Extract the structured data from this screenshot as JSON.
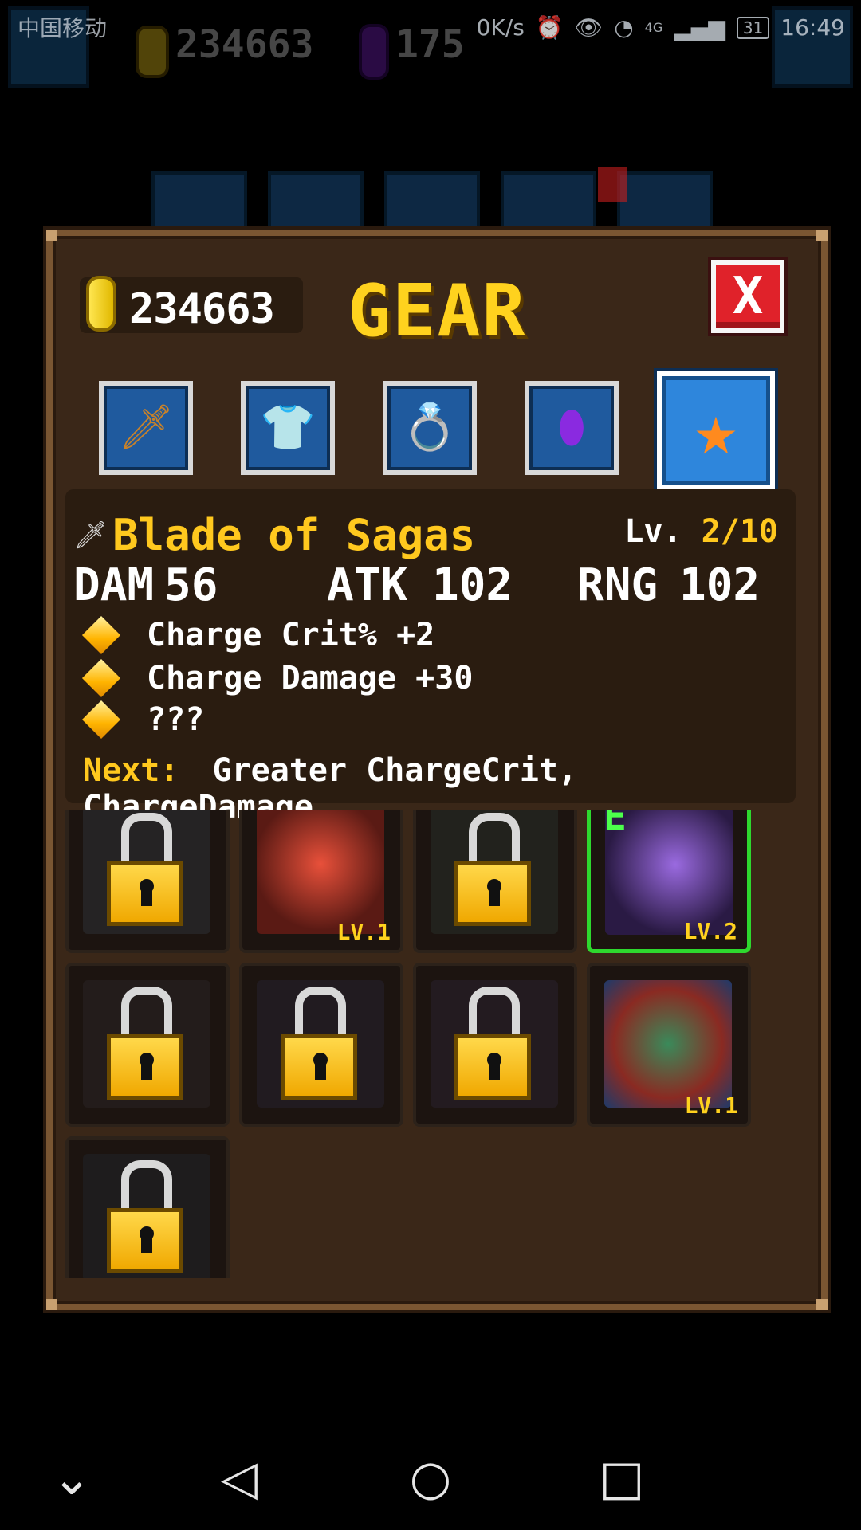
{
  "statusbar": {
    "carrier": "中国移动",
    "speed": "0K/s",
    "network": "4G",
    "battery": "31",
    "time": "16:49"
  },
  "hud": {
    "coins": "234663",
    "gems": "175"
  },
  "panel": {
    "coins": "234663",
    "title": "GEAR",
    "close_label": "X",
    "categories": [
      {
        "name": "weapon",
        "icon": "sword-icon",
        "glyph": "🗡",
        "active": false
      },
      {
        "name": "armor",
        "icon": "shirt-icon",
        "glyph": "👕",
        "active": false
      },
      {
        "name": "ring",
        "icon": "ring-icon",
        "glyph": "💍",
        "active": false
      },
      {
        "name": "gem",
        "icon": "gem-icon",
        "glyph": "⬮",
        "active": false
      },
      {
        "name": "special",
        "icon": "star-icon",
        "glyph": "★",
        "active": true
      }
    ],
    "item": {
      "name": "Blade of Sagas",
      "level_label": "Lv.",
      "level_value": "2/10",
      "stats": {
        "dam_label": "DAM",
        "dam": "56",
        "atk_label": "ATK",
        "atk": "102",
        "rng_label": "RNG",
        "rng": "102"
      },
      "bonuses": [
        "Charge Crit% +2",
        "Charge Damage +30",
        "???"
      ],
      "next_label": "Next:",
      "next_text": "Greater ChargeCrit, ChargeDamage."
    },
    "slots": [
      {
        "state": "locked",
        "art": "#2e3238"
      },
      {
        "state": "owned",
        "level": "LV.1",
        "art": "#c83a2a"
      },
      {
        "state": "locked",
        "art": "#27302a"
      },
      {
        "state": "equipped",
        "level": "LV.2",
        "tag": "E",
        "art": "#5a3a8a"
      },
      {
        "state": "locked",
        "art": "#2a2426"
      },
      {
        "state": "locked",
        "art": "#262230"
      },
      {
        "state": "locked",
        "art": "#2a2230"
      },
      {
        "state": "owned",
        "level": "LV.1",
        "art": "#8a2a22"
      },
      {
        "state": "locked",
        "art": "#20242a"
      }
    ]
  },
  "colors": {
    "accent": "#ffc81e",
    "panel": "#3a2718",
    "equipped": "#2ed82e",
    "close": "#e0222a"
  }
}
